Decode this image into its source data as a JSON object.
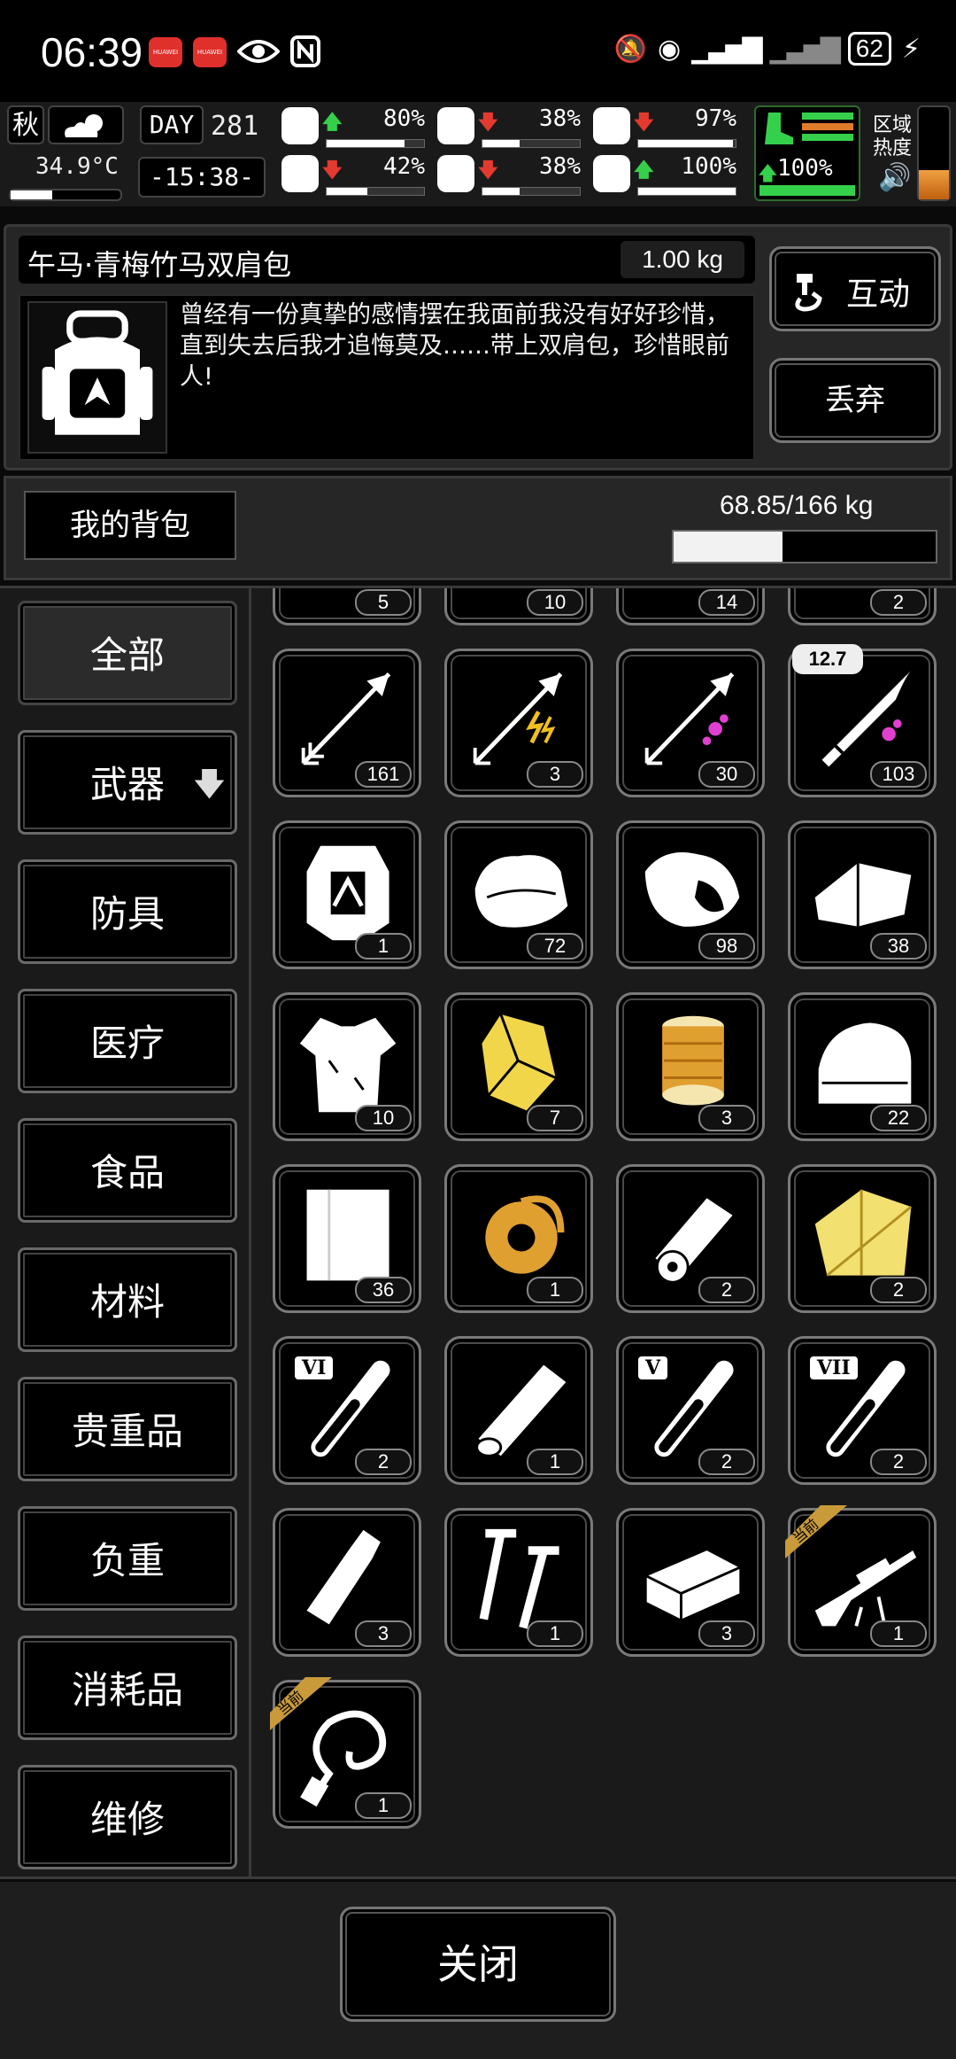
{
  "status_bar": {
    "time": "06:39",
    "battery": "62",
    "icons": [
      "huawei-app-icon",
      "huawei-app-icon",
      "eye-icon",
      "nfc-icon",
      "mute-icon",
      "hotspot-icon",
      "signal-icon",
      "signal-icon",
      "charging-icon"
    ]
  },
  "hud": {
    "season": "秋",
    "temperature": "34.9°C",
    "day_label": "DAY",
    "day": "281",
    "clock": "-15:38-",
    "region_heat_label": "区域热度",
    "stats": [
      {
        "name": "health",
        "icon": "medkit-icon",
        "trend": "up",
        "value": "80%",
        "fill": 0.8
      },
      {
        "name": "hunger",
        "icon": "stomach-icon",
        "trend": "down",
        "value": "38%",
        "fill": 0.38
      },
      {
        "name": "energy",
        "icon": "bandage-icon",
        "trend": "down",
        "value": "97%",
        "fill": 0.97
      },
      {
        "name": "sanity",
        "icon": "brain-icon",
        "trend": "down",
        "value": "42%",
        "fill": 0.42
      },
      {
        "name": "thirst",
        "icon": "water-drop-icon",
        "trend": "down",
        "value": "38%",
        "fill": 0.38
      },
      {
        "name": "mood",
        "icon": "heart-icon",
        "trend": "up",
        "value": "100%",
        "fill": 1.0
      }
    ],
    "stamina": {
      "trend": "up",
      "value": "100%",
      "fill": 1.0
    }
  },
  "item": {
    "name": "午马·青梅竹马双肩包",
    "weight": "1.00 kg",
    "description": "曾经有一份真挚的感情摆在我面前我没有好好珍惜，直到失去后我才追悔莫及……带上双肩包，珍惜眼前人!",
    "interact_label": "互动",
    "discard_label": "丢弃"
  },
  "bag": {
    "label": "我的背包",
    "weight": "68.85/166 kg",
    "fill": 0.415
  },
  "categories": [
    {
      "label": "全部",
      "active": true
    },
    {
      "label": "武器",
      "active": false,
      "arrow": "🡇"
    },
    {
      "label": "防具",
      "active": false
    },
    {
      "label": "医疗",
      "active": false
    },
    {
      "label": "食品",
      "active": false
    },
    {
      "label": "材料",
      "active": false
    },
    {
      "label": "贵重品",
      "active": false
    },
    {
      "label": "负重",
      "active": false
    },
    {
      "label": "消耗品",
      "active": false
    },
    {
      "label": "维修",
      "active": false
    }
  ],
  "current_tag": "当前",
  "items": [
    {
      "icon": "teacup-icon",
      "count": "5"
    },
    {
      "icon": "net-icon",
      "count": "10"
    },
    {
      "icon": "saw-blade-icon",
      "count": "14"
    },
    {
      "icon": "needles-icon",
      "count": "2"
    },
    {
      "icon": "arrow-icon",
      "count": "161"
    },
    {
      "icon": "electric-arrow-icon",
      "count": "3"
    },
    {
      "icon": "poison-arrow-icon",
      "count": "30"
    },
    {
      "icon": "bullet-icon",
      "count": "103",
      "tag": "12.7"
    },
    {
      "icon": "armor-vest-icon",
      "count": "1"
    },
    {
      "icon": "cloth-bundle-icon",
      "count": "72"
    },
    {
      "icon": "raw-meat-icon",
      "count": "98"
    },
    {
      "icon": "folded-cloth-icon",
      "count": "38"
    },
    {
      "icon": "torn-shirt-icon",
      "count": "10"
    },
    {
      "icon": "gold-ore-icon",
      "count": "7"
    },
    {
      "icon": "thread-spool-icon",
      "count": "3"
    },
    {
      "icon": "towel-icon",
      "count": "22"
    },
    {
      "icon": "cloth-sheet-icon",
      "count": "36"
    },
    {
      "icon": "tape-roll-icon",
      "count": "1"
    },
    {
      "icon": "paper-roll-icon",
      "count": "2"
    },
    {
      "icon": "gold-fabric-icon",
      "count": "2"
    },
    {
      "icon": "test-tube-vi-icon",
      "count": "2",
      "tube": "VI"
    },
    {
      "icon": "wood-log-icon",
      "count": "1"
    },
    {
      "icon": "test-tube-v-icon",
      "count": "2",
      "tube": "V"
    },
    {
      "icon": "test-tube-vii-icon",
      "count": "2",
      "tube": "VII"
    },
    {
      "icon": "bottle-icon",
      "count": "3"
    },
    {
      "icon": "screws-icon",
      "count": "1"
    },
    {
      "icon": "brick-icon",
      "count": "3"
    },
    {
      "icon": "sniper-rifle-icon",
      "count": "1",
      "current": true
    },
    {
      "icon": "whip-icon",
      "count": "1",
      "current": true
    }
  ],
  "footer": {
    "close_label": "关闭"
  }
}
